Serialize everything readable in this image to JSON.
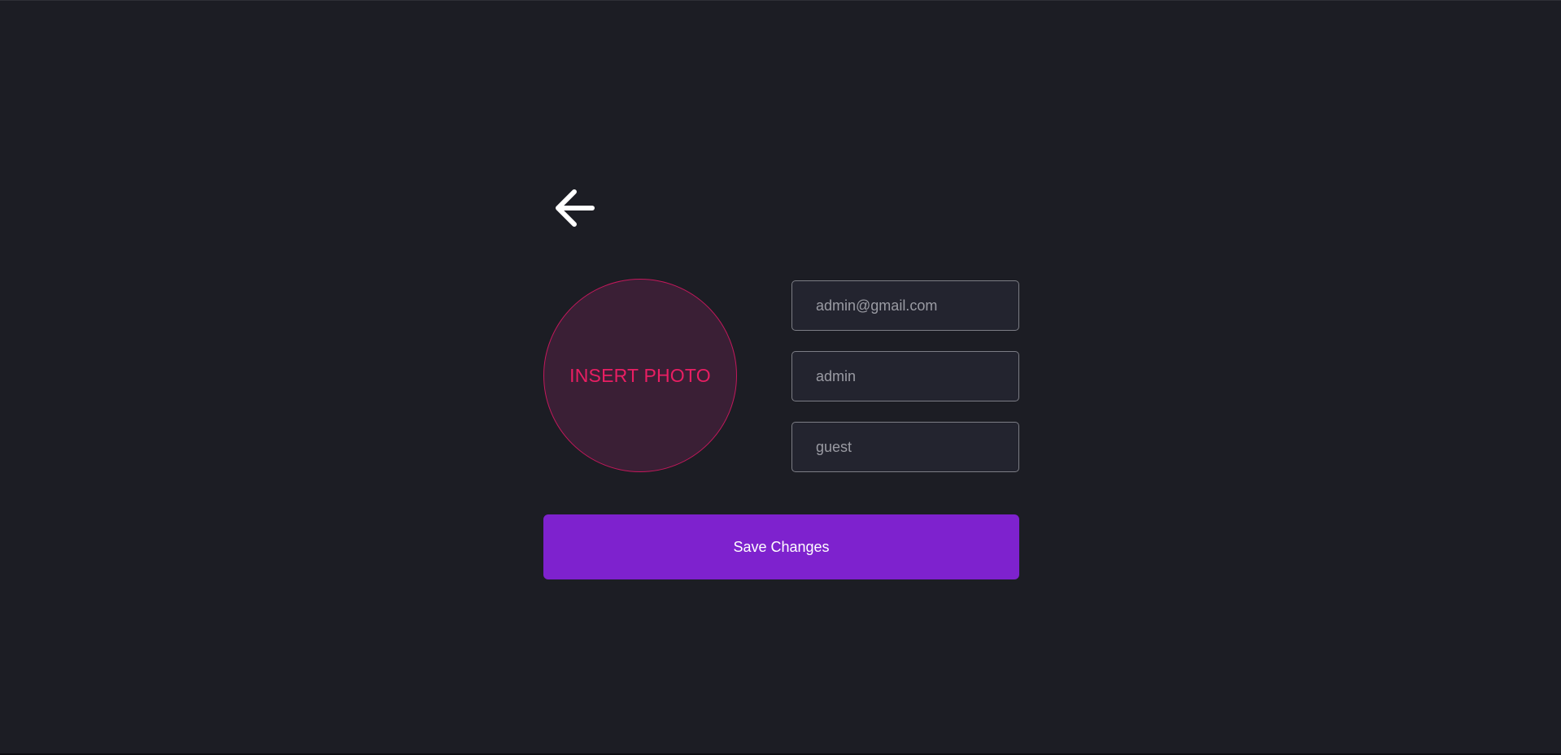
{
  "header": {
    "back_icon": "arrow-left-icon"
  },
  "photo": {
    "label": "INSERT PHOTO",
    "icon": "photo-upload-area"
  },
  "form": {
    "email_placeholder": "admin@gmail.com",
    "name_placeholder": "admin",
    "role_placeholder": "guest"
  },
  "actions": {
    "save_label": "Save Changes"
  },
  "colors": {
    "background": "#1c1d24",
    "accent": "#7e22ce",
    "photo_accent": "#e91e63",
    "photo_fill": "#3a1f35",
    "field_border": "#7c7d85",
    "field_fill": "#23242f"
  }
}
